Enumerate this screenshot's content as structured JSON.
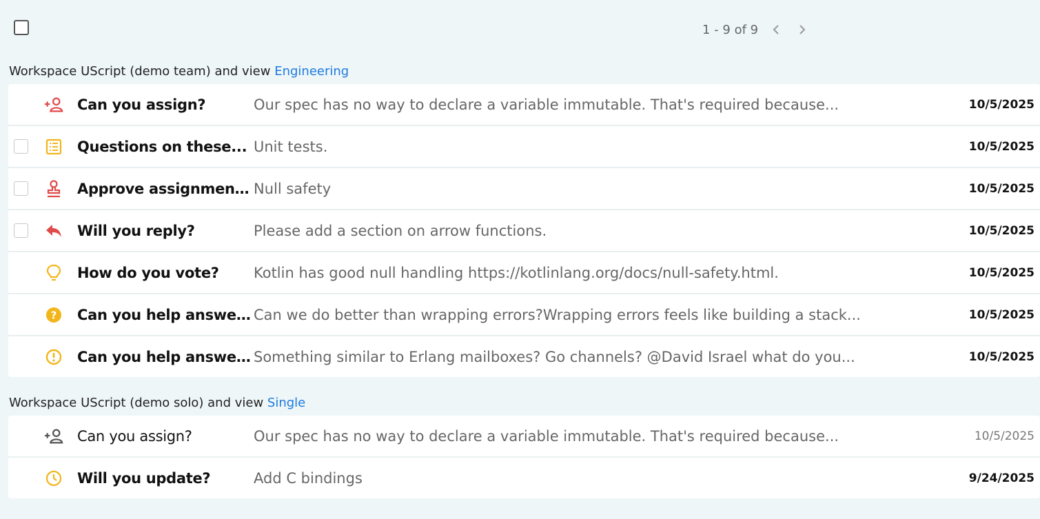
{
  "pager": {
    "range": "1 - 9 of 9"
  },
  "groups": [
    {
      "prefix": "Workspace UScript (demo team) and view ",
      "view": "Engineering",
      "rows": [
        {
          "icon": "assign-person-icon",
          "icon_color": "#e04a4a",
          "title": "Can you assign?",
          "snippet": "Our spec has no way to declare a variable immutable. That's required because...",
          "date": "10/5/2025"
        },
        {
          "icon": "list-icon",
          "icon_color": "#f2b51a",
          "title": "Questions on these...",
          "snippet": "Unit tests.",
          "date": "10/5/2025"
        },
        {
          "icon": "approve-stamp-icon",
          "icon_color": "#e04a4a",
          "title": "Approve assignment...",
          "snippet": "Null safety",
          "date": "10/5/2025"
        },
        {
          "icon": "reply-icon",
          "icon_color": "#e04a4a",
          "title": "Will you reply?",
          "snippet": "Please add a section on arrow functions.",
          "date": "10/5/2025"
        },
        {
          "icon": "lightbulb-icon",
          "icon_color": "#f2b51a",
          "title": "How do you vote?",
          "snippet": "Kotlin has good null handling https://kotlinlang.org/docs/null-safety.html.",
          "date": "10/5/2025"
        },
        {
          "icon": "question-icon",
          "icon_color": "#f2b51a",
          "title": "Can you help answer...",
          "snippet": "Can we do better than wrapping errors?Wrapping errors feels like building a stack...",
          "date": "10/5/2025"
        },
        {
          "icon": "alert-icon",
          "icon_color": "#f2b51a",
          "title": "Can you help answer...",
          "snippet": "Something similar to Erlang mailboxes? Go channels? @David Israel what do you...",
          "date": "10/5/2025"
        }
      ]
    },
    {
      "prefix": "Workspace UScript (demo solo) and view ",
      "view": "Single",
      "rows": [
        {
          "icon": "assign-person-icon",
          "icon_color": "#555555",
          "title": "Can you assign?",
          "snippet": "Our spec has no way to declare a variable immutable. That's required because...",
          "date": "10/5/2025"
        },
        {
          "icon": "clock-icon",
          "icon_color": "#f2b51a",
          "title": "Will you update?",
          "snippet": "Add C bindings",
          "date": "9/24/2025"
        }
      ]
    }
  ]
}
